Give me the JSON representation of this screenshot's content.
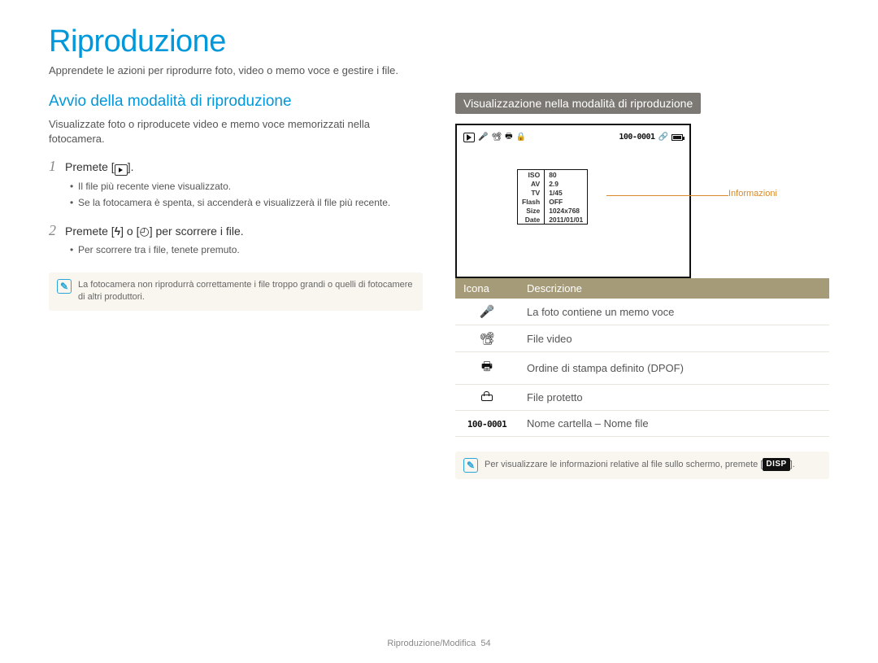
{
  "page_title": "Riproduzione",
  "subtitle": "Apprendete le azioni per riprodurre foto, video o memo voce e gestire i file.",
  "left": {
    "heading": "Avvio della modalità di riproduzione",
    "desc": "Visualizzate foto o riproducete video e memo voce memorizzati nella fotocamera.",
    "step1_label": "Premete [",
    "step1_label_end": "].",
    "step1_bullets": [
      "Il file più recente viene visualizzato.",
      "Se la fotocamera è spenta, si accenderà e visualizzerà il file più recente."
    ],
    "step2_label_a": "Premete [",
    "step2_label_b": "] o [",
    "step2_label_c": "] per scorrere i file.",
    "step2_bullets": [
      "Per scorrere tra i file, tenete premuto."
    ],
    "note": "La fotocamera non riprodurrà correttamente i file troppo grandi o quelli di fotocamere di altri produttori."
  },
  "right": {
    "band_heading": "Visualizzazione nella modalità di riproduzione",
    "info_label": "Informazioni",
    "screen": {
      "file_num": "100-0001",
      "info_rows": [
        {
          "k": "ISO",
          "v": "80"
        },
        {
          "k": "AV",
          "v": "2.9"
        },
        {
          "k": "TV",
          "v": "1/45"
        },
        {
          "k": "Flash",
          "v": "OFF"
        },
        {
          "k": "Size",
          "v": "1024x768"
        },
        {
          "k": "Date",
          "v": "2011/01/01"
        }
      ]
    },
    "table": {
      "h_icon": "Icona",
      "h_desc": "Descrizione",
      "rows": [
        {
          "icon": "mic",
          "desc": "La foto contiene un memo voce"
        },
        {
          "icon": "video",
          "desc": "File video"
        },
        {
          "icon": "printer",
          "desc": "Ordine di stampa definito (DPOF)"
        },
        {
          "icon": "lock",
          "desc": "File protetto"
        },
        {
          "icon": "filenum",
          "desc": "Nome cartella – Nome file"
        }
      ]
    },
    "note_a": "Per visualizzare le informazioni relative al file sullo schermo, premete [",
    "note_b": "]."
  },
  "footer": {
    "section": "Riproduzione/Modifica",
    "page": "54"
  }
}
